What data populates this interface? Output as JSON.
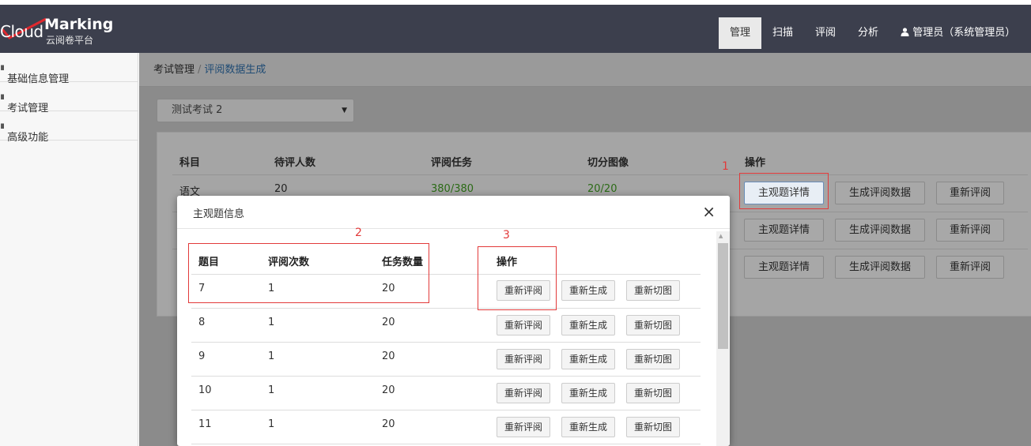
{
  "logo": {
    "cloud": "Cloud",
    "marking": "Marking",
    "subtitle": "云阅卷平台"
  },
  "nav": {
    "items": [
      "管理",
      "扫描",
      "评阅",
      "分析"
    ],
    "active": "管理",
    "user": "管理员（系统管理员）"
  },
  "sidebar": {
    "items": [
      "基础信息管理",
      "考试管理",
      "高级功能"
    ]
  },
  "breadcrumb": {
    "parent": "考试管理",
    "separator": "/",
    "current": "评阅数据生成"
  },
  "exam_select": {
    "value": "测试考试 2"
  },
  "subject_table": {
    "headers": [
      "科目",
      "待评人数",
      "评阅任务",
      "切分图像",
      "操作"
    ],
    "rows": [
      {
        "subject": "语文",
        "pending": "20",
        "tasks": "380/380",
        "images": "20/20"
      }
    ],
    "actions": [
      "主观题详情",
      "生成评阅数据",
      "重新评阅"
    ]
  },
  "annotations": [
    "1",
    "2",
    "3"
  ],
  "modal": {
    "title": "主观题信息",
    "close": "×",
    "headers": [
      "题目",
      "评阅次数",
      "任务数量",
      "操作"
    ],
    "rows": [
      {
        "q": "7",
        "times": "1",
        "count": "20"
      },
      {
        "q": "8",
        "times": "1",
        "count": "20"
      },
      {
        "q": "9",
        "times": "1",
        "count": "20"
      },
      {
        "q": "10",
        "times": "1",
        "count": "20"
      },
      {
        "q": "11",
        "times": "1",
        "count": "20"
      }
    ],
    "actions": [
      "重新评阅",
      "重新生成",
      "重新切图"
    ]
  },
  "colors": {
    "topbar": "#3c3f4d",
    "annotation_red": "#e23a3a",
    "link_blue": "#2f6fa8",
    "green_text": "#2b6b16"
  }
}
